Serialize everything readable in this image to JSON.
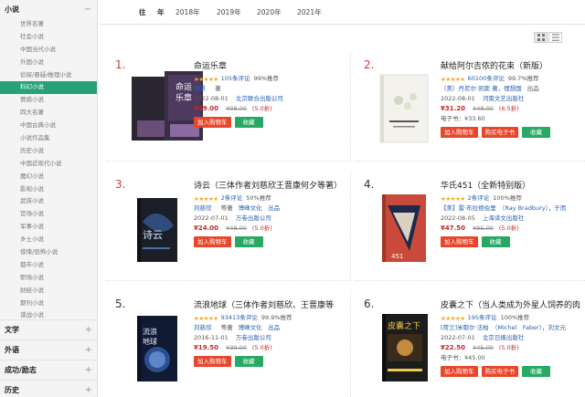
{
  "sidebar": {
    "main_category": "小说",
    "sub_items": [
      "世界名著",
      "社会小说",
      "中国当代小说",
      "外国小说",
      "侦探/悬疑/推理小说",
      "科幻小说",
      "情感小说",
      "四大名著",
      "中国古典小说",
      "小说作品集",
      "历史小说",
      "中国近现代小说",
      "魔幻小说",
      "影视小说",
      "武侠小说",
      "官场小说",
      "军事小说",
      "乡土小说",
      "惊悚/恐怖小说",
      "都市小说",
      "职场小说",
      "财经小说",
      "期刊小说",
      "谍战小说"
    ],
    "active_index": 5,
    "bottom_categories": [
      "文学",
      "外语",
      "成功/励志",
      "历史"
    ]
  },
  "yearbar": {
    "label": "往 年",
    "years": [
      "2018年",
      "2019年",
      "2020年",
      "2021年"
    ]
  },
  "books": [
    {
      "rank": "1.",
      "title": "命运乐章",
      "reviews": "105条评论",
      "recommend": "99%推荐",
      "author": "郑景",
      "role": "著",
      "date": "2022-08-01",
      "publisher": "北京联合出版公司",
      "price": "¥49.00",
      "original": "¥98.00",
      "discount": "(5.0折)",
      "ebook": "",
      "buttons": [
        "加入购物车",
        "收藏"
      ]
    },
    {
      "rank": "2.",
      "title": "献给阿尔吉侬的花束（新版）",
      "reviews": "60100条评论",
      "recommend": "99.7%推荐",
      "author": "（美）丹尼尔·凯斯",
      "role": "著，理想国",
      "role2": "出品",
      "date": "2022-08-01",
      "publisher": "河南文艺出版社",
      "price": "¥31.20",
      "original": "¥48.00",
      "discount": "(6.5折)",
      "ebook": "电子书：¥33.60",
      "buttons": [
        "加入购物车",
        "购买电子书",
        "收藏"
      ]
    },
    {
      "rank": "3.",
      "title": "诗云（三体作者刘慈欣王晋康何夕等著）",
      "reviews": "2条评论",
      "recommend": "50%推荐",
      "author": "刘慈欣",
      "role": "等著",
      "role2": "博峰文化　出品",
      "date": "2022-07-01",
      "publisher": "万卷出版公司",
      "price": "¥24.00",
      "original": "¥48.00",
      "discount": "(5.0折)",
      "ebook": "",
      "buttons": [
        "加入购物车",
        "收藏"
      ]
    },
    {
      "rank": "4.",
      "title": "华氏451（全新特别版）",
      "reviews": "2条评论",
      "recommend": "100%推荐",
      "author": "【美】雷·布拉德伯里　（Ray Bradbury）",
      "role": "，于而",
      "date": "2022-08-05",
      "publisher": "上海译文出版社",
      "price": "¥47.50",
      "original": "¥95.00",
      "discount": "(5.0折)",
      "ebook": "",
      "buttons": [
        "加入购物车",
        "收藏"
      ]
    },
    {
      "rank": "5.",
      "title": "流浪地球（三体作者刘慈欣、王晋康等",
      "reviews": "93413条评论",
      "recommend": "99.9%推荐",
      "author": "刘慈欣",
      "role": "等著",
      "role2": "博峰文化　出品",
      "date": "2016-11-01",
      "publisher": "万卷出版公司",
      "price": "¥19.50",
      "original": "¥39.00",
      "discount": "(5.0折)",
      "ebook": "",
      "buttons": [
        "加入购物车",
        "收藏"
      ]
    },
    {
      "rank": "6.",
      "title": "皮囊之下（当人类成为外星人饲养的肉",
      "reviews": "195条评论",
      "recommend": "100%推荐",
      "author": "[荷兰]米歇尔·法柏　（Michel　Faber）",
      "role": "，刘文元",
      "date": "2022-07-01",
      "publisher": "北京日报出版社",
      "price": "¥22.50",
      "original": "¥45.00",
      "discount": "(5.0折)",
      "ebook": "电子书：¥45.00",
      "buttons": [
        "加入购物车",
        "购买电子书",
        "收藏"
      ]
    }
  ]
}
